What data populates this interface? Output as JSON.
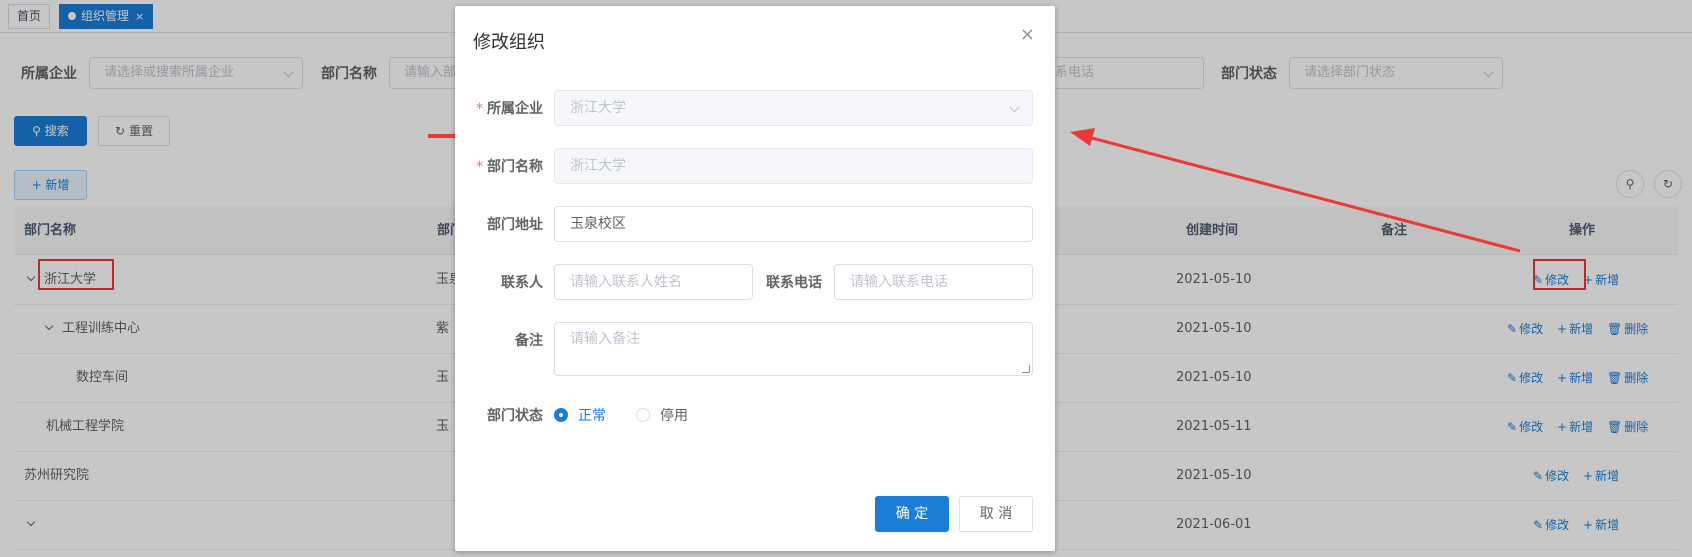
{
  "tags": [
    {
      "label": "首页",
      "active": false
    },
    {
      "label": "组织管理",
      "active": true,
      "close": "×"
    }
  ],
  "search": {
    "enterprise_label": "所属企业",
    "enterprise_placeholder": "请选择或搜索所属企业",
    "dept_name_label": "部门名称",
    "dept_name_placeholder": "请输入部",
    "phone_placeholder_tail": "系电话",
    "status_label": "部门状态",
    "status_placeholder": "请选择部门状态",
    "search_button": "搜索",
    "reset_button": "重置",
    "add_button": "+ 新增"
  },
  "table": {
    "headers": {
      "name": "部门名称",
      "address": "部门",
      "created": "创建时间",
      "remark": "备注",
      "ops": "操作"
    },
    "rows": [
      {
        "name": "浙江大学",
        "address": "玉泉",
        "created": "2021-05-10",
        "expand": true,
        "indent": 0,
        "ops": [
          "修改",
          "新增"
        ]
      },
      {
        "name": "工程训练中心",
        "address": "紫",
        "created": "2021-05-10",
        "expand": true,
        "indent": 1,
        "ops": [
          "修改",
          "新增",
          "删除"
        ]
      },
      {
        "name": "数控车间",
        "address": "玉",
        "created": "2021-05-10",
        "expand": false,
        "indent": 2,
        "ops": [
          "修改",
          "新增",
          "删除"
        ]
      },
      {
        "name": "机械工程学院",
        "address": "玉",
        "created": "2021-05-11",
        "expand": false,
        "indent": 1,
        "ops": [
          "修改",
          "新增",
          "删除"
        ]
      },
      {
        "name": "苏州研究院",
        "address": "",
        "created": "2021-05-10",
        "expand": false,
        "indent": -1,
        "ops": [
          "修改",
          "新增"
        ]
      },
      {
        "name": "",
        "address": "",
        "created": "2021-06-01",
        "expand": true,
        "indent": 0,
        "ops": [
          "修改",
          "新增"
        ]
      }
    ]
  },
  "dialog": {
    "title": "修改组织",
    "close": "×",
    "enterprise_label": "所属企业",
    "enterprise_value": "浙江大学",
    "dept_name_label": "部门名称",
    "dept_name_value": "浙江大学",
    "address_label": "部门地址",
    "address_value": "玉泉校区",
    "contact_label": "联系人",
    "contact_placeholder": "请输入联系人姓名",
    "phone_label": "联系电话",
    "phone_placeholder": "请输入联系电话",
    "remark_label": "备注",
    "remark_placeholder": "请输入备注",
    "status_label": "部门状态",
    "status_normal": "正常",
    "status_disabled": "停用",
    "required_mark": "*",
    "confirm_button": "确 定",
    "cancel_button": "取 消"
  },
  "colors": {
    "primary": "#1a7dd6",
    "highlight": "#ea3a35"
  }
}
